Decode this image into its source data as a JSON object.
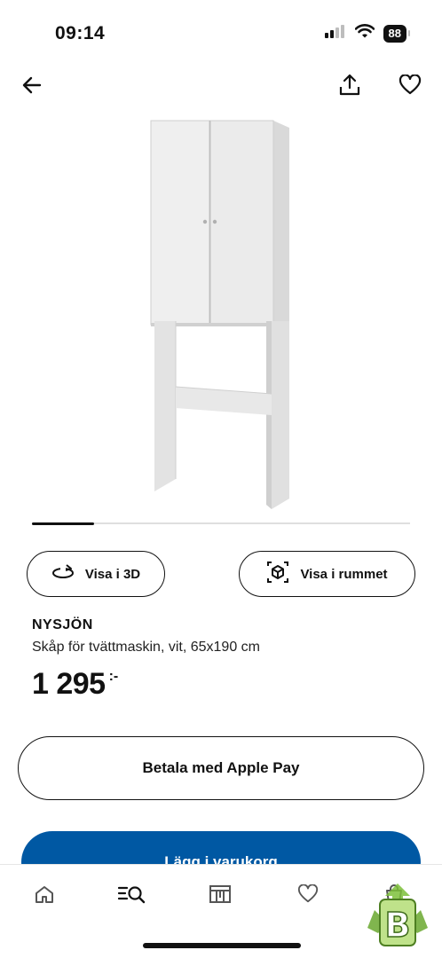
{
  "status_bar": {
    "time": "09:14",
    "battery_level": "88",
    "icons": [
      "signal-icon",
      "wifi-icon",
      "battery-icon"
    ]
  },
  "top_nav": {
    "icons": [
      "back-arrow-icon",
      "share-icon",
      "heart-icon"
    ]
  },
  "gallery": {
    "image_progress_fraction": 0.165
  },
  "actions": {
    "view_3d_label": "Visa i 3D",
    "view_in_room_label": "Visa i rummet"
  },
  "product": {
    "name": "NYSJÖN",
    "description": "Skåp för tvättmaskin, vit, 65x190 cm",
    "price_integer": "1 295",
    "price_suffix": ":-"
  },
  "checkout": {
    "apple_pay_label": "Betala med Apple Pay",
    "add_to_cart_label": "Lägg i varukorg"
  },
  "tab_bar": {
    "tabs": [
      "home-icon",
      "search-icon",
      "store-icon",
      "wishlist-heart-icon",
      "bag-icon"
    ]
  },
  "colors": {
    "accent_blue": "#0058a3",
    "text": "#111111",
    "progress_track": "#dfdfdf"
  }
}
